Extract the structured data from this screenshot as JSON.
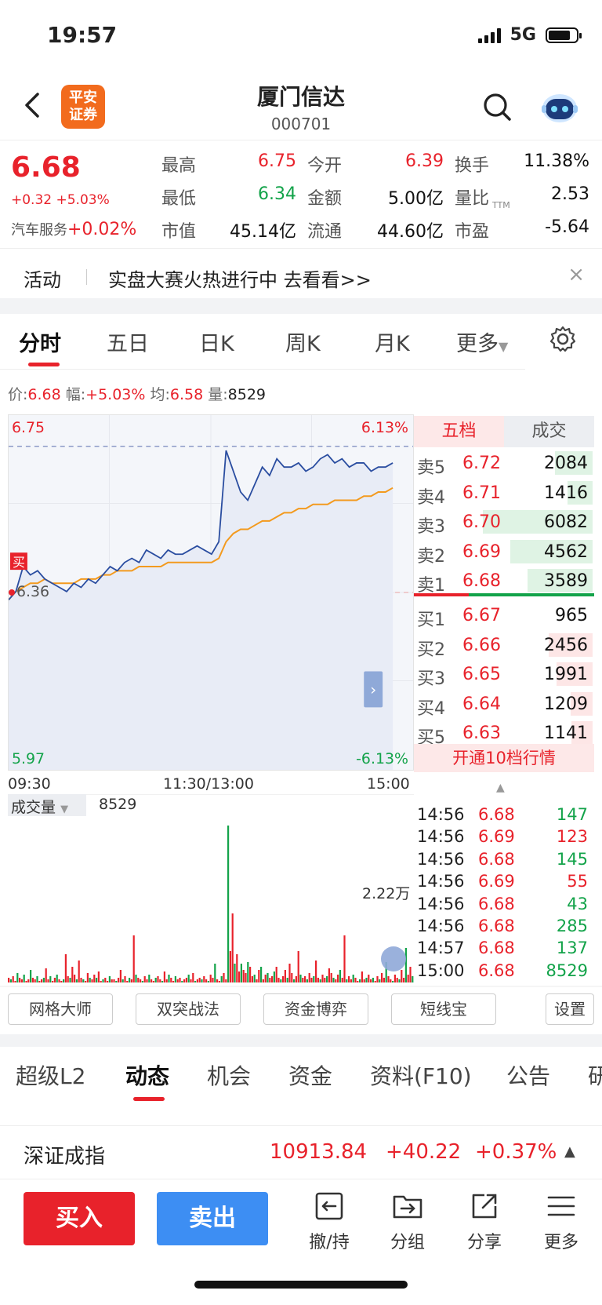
{
  "status_bar": {
    "time": "19:57",
    "network": "5G"
  },
  "header": {
    "name": "厦门信达",
    "code": "000701",
    "broker_logo": "平安\n证券",
    "icons": [
      "back-icon",
      "search-icon",
      "robot-assistant-icon"
    ]
  },
  "quote": {
    "price": "6.68",
    "change": "+0.32 +5.03%",
    "sector_label": "汽车服务",
    "sector_change": "+0.02%",
    "stats": [
      {
        "label": "最高",
        "value": "6.75",
        "color": "red"
      },
      {
        "label": "今开",
        "value": "6.39",
        "color": "red"
      },
      {
        "label": "换手",
        "value": "11.38%",
        "color": "black"
      },
      {
        "label": "最低",
        "value": "6.34",
        "color": "green"
      },
      {
        "label": "金额",
        "value": "5.00亿",
        "color": "black"
      },
      {
        "label": "量比",
        "value": "2.53",
        "color": "black"
      },
      {
        "label": "市值",
        "value": "45.14亿",
        "color": "black"
      },
      {
        "label": "流通",
        "value": "44.60亿",
        "color": "black"
      },
      {
        "label": "市盈",
        "value": "-5.64",
        "color": "black"
      }
    ],
    "pe_sup": "TTM"
  },
  "activity": {
    "label": "活动",
    "text": "实盘大赛火热进行中 去看看>>",
    "close": "×"
  },
  "chart_tabs": [
    "分时",
    "五日",
    "日K",
    "周K",
    "月K",
    "更多"
  ],
  "info_bar": {
    "price_label": "价:",
    "price": "6.68",
    "amp_label": "幅:",
    "amp": "+5.03%",
    "avg_label": "均:",
    "avg": "6.58",
    "vol_label": "量:",
    "vol": "8529"
  },
  "chart_labels": {
    "top_left": "6.75",
    "top_right": "6.13%",
    "bottom_left": "5.97",
    "bottom_right": "-6.13%",
    "mid_left": "6.36",
    "buy_marker": "买",
    "x_labels": [
      "09:30",
      "11:30/13:00",
      "15:00"
    ]
  },
  "volume": {
    "label": "成交量",
    "value": "8529",
    "max": "2.22万"
  },
  "chart_data": {
    "type": "line",
    "ylim": [
      5.97,
      6.75
    ],
    "prev_close": 6.36,
    "series": [
      {
        "values": [
          6.38,
          6.4,
          6.46,
          6.44,
          6.45,
          6.43,
          6.42,
          6.41,
          6.4,
          6.42,
          6.41,
          6.43,
          6.42,
          6.44,
          6.46,
          6.45,
          6.47,
          6.48,
          6.47,
          6.5,
          6.49,
          6.48,
          6.5,
          6.49,
          6.49,
          6.5,
          6.51,
          6.5,
          6.49,
          6.52,
          6.74,
          6.69,
          6.64,
          6.62,
          6.66,
          6.7,
          6.68,
          6.72,
          6.7,
          6.7,
          6.71,
          6.69,
          6.7,
          6.72,
          6.73,
          6.71,
          6.72,
          6.7,
          6.71,
          6.71,
          6.69,
          6.7,
          6.7,
          6.71
        ]
      },
      {
        "values": [
          6.38,
          6.4,
          6.41,
          6.42,
          6.42,
          6.43,
          6.42,
          6.42,
          6.42,
          6.42,
          6.43,
          6.43,
          6.43,
          6.44,
          6.44,
          6.45,
          6.45,
          6.45,
          6.46,
          6.46,
          6.46,
          6.46,
          6.47,
          6.47,
          6.47,
          6.47,
          6.47,
          6.47,
          6.47,
          6.48,
          6.52,
          6.54,
          6.55,
          6.55,
          6.56,
          6.57,
          6.57,
          6.58,
          6.59,
          6.59,
          6.6,
          6.6,
          6.61,
          6.61,
          6.61,
          6.62,
          6.62,
          6.62,
          6.62,
          6.63,
          6.63,
          6.64,
          6.64,
          6.65
        ]
      }
    ]
  },
  "volume_data": {
    "values": [
      3,
      2,
      4,
      1,
      6,
      3,
      2,
      5,
      1,
      2,
      8,
      3,
      2,
      4,
      1,
      2,
      3,
      9,
      2,
      4,
      1,
      3,
      5,
      2,
      1,
      2,
      18,
      4,
      3,
      10,
      5,
      2,
      14,
      3,
      2,
      1,
      6,
      3,
      2,
      5,
      3,
      7,
      1,
      2,
      3,
      1,
      4,
      2,
      2,
      1,
      3,
      8,
      2,
      4,
      1,
      3,
      2,
      30,
      5,
      3,
      2,
      1,
      4,
      2,
      5,
      2,
      1,
      3,
      4,
      2,
      1,
      7,
      2,
      5,
      3,
      1,
      4,
      2,
      3,
      1,
      2,
      3,
      5,
      2,
      6,
      1,
      2,
      3,
      2,
      4,
      2,
      1,
      5,
      3,
      12,
      2,
      1,
      4,
      6,
      2,
      100,
      20,
      44,
      12,
      18,
      7,
      12,
      8,
      6,
      13,
      10,
      4,
      5,
      2,
      8,
      10,
      2,
      5,
      6,
      3,
      4,
      7,
      10,
      3,
      2,
      4,
      8,
      3,
      12,
      6,
      2,
      4,
      20,
      5,
      3,
      4,
      2,
      6,
      3,
      4,
      14,
      3,
      2,
      5,
      3,
      4,
      9,
      6,
      3,
      2,
      5,
      8,
      3,
      30,
      2,
      4,
      2,
      5,
      3,
      1,
      2,
      7,
      2,
      3,
      5,
      2,
      3,
      1,
      4,
      2,
      6,
      3,
      13,
      4,
      2,
      1,
      5,
      3,
      2,
      8,
      3,
      22,
      5,
      10,
      4
    ]
  },
  "orderbook": {
    "tabs": [
      "五档",
      "成交"
    ],
    "sell": [
      {
        "label": "卖5",
        "price": "6.72",
        "vol": "2084",
        "frac": 0.34
      },
      {
        "label": "卖4",
        "price": "6.71",
        "vol": "1416",
        "frac": 0.23
      },
      {
        "label": "卖3",
        "price": "6.70",
        "vol": "6082",
        "frac": 1.0
      },
      {
        "label": "卖2",
        "price": "6.69",
        "vol": "4562",
        "frac": 0.75
      },
      {
        "label": "卖1",
        "price": "6.68",
        "vol": "3589",
        "frac": 0.59
      }
    ],
    "buy": [
      {
        "label": "买1",
        "price": "6.67",
        "vol": "965",
        "frac": 0.0
      },
      {
        "label": "买2",
        "price": "6.66",
        "vol": "2456",
        "frac": 0.4
      },
      {
        "label": "买3",
        "price": "6.65",
        "vol": "1991",
        "frac": 0.33
      },
      {
        "label": "买4",
        "price": "6.64",
        "vol": "1209",
        "frac": 0.2
      },
      {
        "label": "买5",
        "price": "6.63",
        "vol": "1141",
        "frac": 0.19
      }
    ],
    "open10": "开通10档行情"
  },
  "ticks": [
    {
      "time": "14:56",
      "price": "6.68",
      "vol": "147"
    },
    {
      "time": "14:56",
      "price": "6.69",
      "vol": "123"
    },
    {
      "time": "14:56",
      "price": "6.68",
      "vol": "145"
    },
    {
      "time": "14:56",
      "price": "6.69",
      "vol": "55"
    },
    {
      "time": "14:56",
      "price": "6.68",
      "vol": "43"
    },
    {
      "time": "14:56",
      "price": "6.68",
      "vol": "285"
    },
    {
      "time": "14:57",
      "price": "6.68",
      "vol": "137"
    },
    {
      "time": "15:00",
      "price": "6.68",
      "vol": "8529"
    }
  ],
  "tools": [
    "网格大师",
    "双突战法",
    "资金博弈",
    "短线宝",
    "设置"
  ],
  "detail_tabs": [
    "超级L2",
    "动态",
    "机会",
    "资金",
    "资料(F10)",
    "公告",
    "研"
  ],
  "index": {
    "name": "深证成指",
    "value": "10913.84",
    "change": "+40.22",
    "pct": "+0.37%"
  },
  "bottom": {
    "buy": "买入",
    "sell": "卖出",
    "nav": [
      "撤/持",
      "分组",
      "分享",
      "更多"
    ]
  },
  "colors": {
    "up": "#e8222b",
    "down": "#13a34a",
    "accent": "#e8222b",
    "sell_button": "#3d8ef3",
    "price_line": "#2a4da0",
    "avg_line": "#f39a1e"
  }
}
